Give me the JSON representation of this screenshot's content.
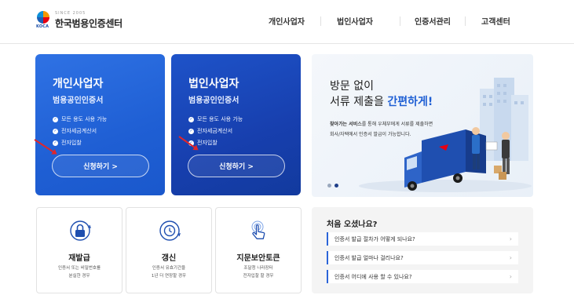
{
  "header": {
    "logo_since": "SINCE 2005",
    "logo_abbr": "KOCA",
    "logo_name": "한국범용인증센터",
    "nav": [
      "개인사업자",
      "법인사업자",
      "인증서관리",
      "고객센터"
    ]
  },
  "cards": [
    {
      "title": "개인사업자",
      "subtitle": "범용공인인증서",
      "features": [
        "모든 용도 사용 가능",
        "전자세금계산서",
        "전자입찰"
      ],
      "button": "신청하기 >"
    },
    {
      "title": "법인사업자",
      "subtitle": "범용공인인증서",
      "features": [
        "모든 용도 사용 가능",
        "전자세금계산서",
        "전자입찰"
      ],
      "button": "신청하기 >"
    }
  ],
  "banner": {
    "line1": "방문 없이",
    "line2_prefix": "서류 제출을 ",
    "line2_highlight": "간편하게!",
    "desc_bold": "찾아가는 서비스",
    "desc_rest": "를 통해 우체부에게 서류를 제출하면",
    "desc_line2": "회사/자택에서 인증서 발급이 가능합니다."
  },
  "services": [
    {
      "name": "재발급",
      "desc": [
        "인증서 또는 비밀번호를",
        "분실한 경우"
      ],
      "icon": "lock-refresh-icon"
    },
    {
      "name": "갱신",
      "desc": [
        "인증서 유효기간을",
        "1년 더 연장할 경우"
      ],
      "icon": "clock-refresh-icon"
    },
    {
      "name": "지문보안토큰",
      "desc": [
        "조달청 나라장터",
        "전자입찰 할 경우"
      ],
      "icon": "fingerprint-touch-icon"
    }
  ],
  "faq": {
    "title": "처음 오셨나요?",
    "items": [
      "인증서 발급 절차가 어떻게 되나요?",
      "인증서 발급 얼마나 걸리나요?",
      "인증서 어디에 사용 할 수 있나요?"
    ]
  },
  "colors": {
    "accent": "#1f5fd4",
    "card1": "#2a64d8",
    "card2": "#1a47b8",
    "annotation_arrow": "#e0262b"
  }
}
